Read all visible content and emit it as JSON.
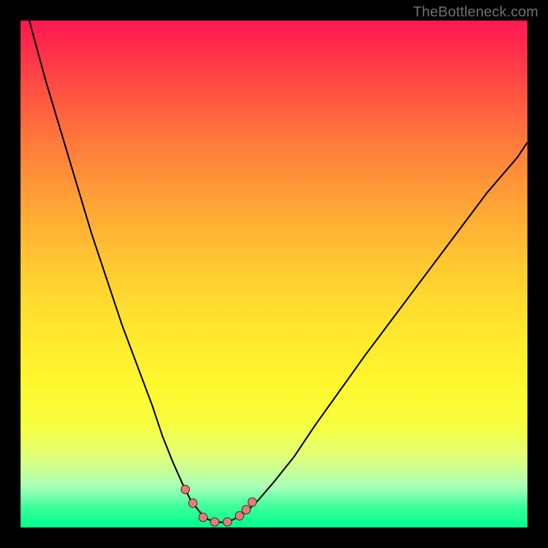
{
  "watermark": "TheBottleneck.com",
  "palette": {
    "curve": "#000000",
    "marker_fill": "#e97a74",
    "marker_stroke": "#2b2b2b"
  },
  "chart_data": {
    "type": "line",
    "title": "",
    "xlabel": "",
    "ylabel": "",
    "xlim": [
      0,
      100
    ],
    "ylim": [
      0,
      100
    ],
    "grid": false,
    "left_curve": {
      "x": [
        0,
        2,
        5,
        8,
        11,
        14,
        17,
        20,
        23,
        26,
        28,
        30,
        32,
        33.5,
        35,
        36,
        37
      ],
      "y": [
        107,
        99,
        88,
        78,
        68,
        58,
        49,
        40,
        32,
        24,
        18,
        13,
        8.5,
        5.5,
        3.5,
        2.3,
        1.6
      ]
    },
    "right_curve": {
      "x": [
        42,
        43.5,
        45,
        47,
        50,
        54,
        58,
        63,
        68,
        74,
        80,
        86,
        92,
        98,
        100
      ],
      "y": [
        1.6,
        2.3,
        3.5,
        5.5,
        9,
        14,
        20,
        27,
        34,
        42,
        50,
        58,
        66,
        73,
        76
      ]
    },
    "trough": {
      "x": [
        37,
        38.5,
        40,
        41,
        42
      ],
      "y": [
        1.6,
        1.1,
        1.0,
        1.1,
        1.6
      ]
    },
    "markers": [
      {
        "x": 32.5,
        "y": 7.5
      },
      {
        "x": 34.0,
        "y": 4.8
      },
      {
        "x": 36.0,
        "y": 2.0
      },
      {
        "x": 38.3,
        "y": 1.1
      },
      {
        "x": 40.8,
        "y": 1.1
      },
      {
        "x": 43.2,
        "y": 2.3
      },
      {
        "x": 44.5,
        "y": 3.5
      },
      {
        "x": 45.7,
        "y": 5.0
      }
    ]
  }
}
